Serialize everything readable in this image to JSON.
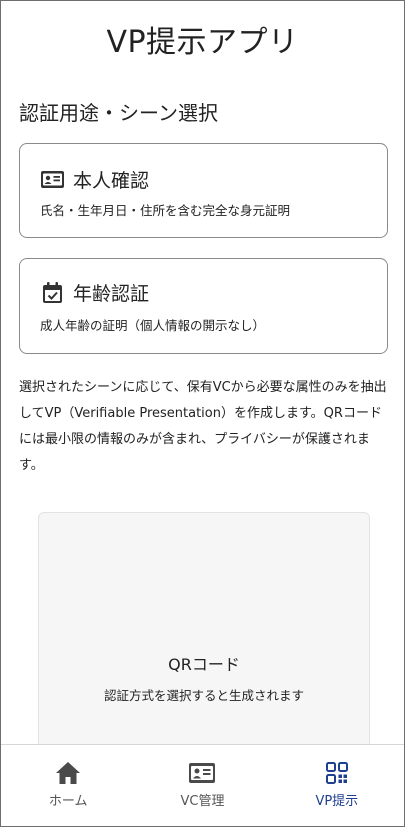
{
  "app": {
    "title": "VP提示アプリ"
  },
  "section": {
    "title": "認証用途・シーン選択"
  },
  "cards": [
    {
      "title": "本人確認",
      "description": "氏名・生年月日・住所を含む完全な身元証明",
      "icon": "id-card-icon"
    },
    {
      "title": "年齢認証",
      "description": "成人年齢の証明（個人情報の開示なし）",
      "icon": "calendar-check-icon"
    }
  ],
  "description": "選択されたシーンに応じて、保有VCから必要な属性のみを抽出してVP（Verifiable Presentation）を作成します。QRコードには最小限の情報のみが含まれ、プライバシーが保護されます。",
  "qr": {
    "title": "QRコード",
    "subtitle": "認証方式を選択すると生成されます"
  },
  "nav": {
    "items": [
      {
        "label": "ホーム",
        "icon": "home-icon",
        "active": false
      },
      {
        "label": "VC管理",
        "icon": "id-card-icon",
        "active": false
      },
      {
        "label": "VP提示",
        "icon": "qr-code-icon",
        "active": true
      }
    ]
  },
  "colors": {
    "icon_dark": "#333333",
    "active": "#1f3f8f",
    "nav_icon": "#4a4a4a"
  }
}
